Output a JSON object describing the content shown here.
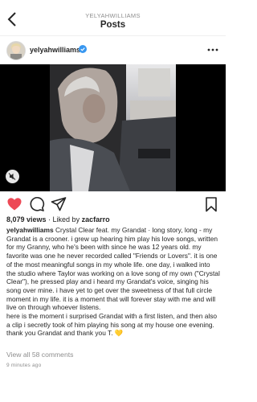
{
  "nav": {
    "account": "YELYAHWILLIAMS",
    "title": "Posts"
  },
  "post": {
    "username": "yelyahwilliams",
    "views_count": "8,079 views",
    "liked_by_prefix": " · Liked by ",
    "liked_by_user": "zacfarro",
    "caption_user": "yelyahwilliams",
    "caption_p1": " Crystal Clear feat. my Grandat · long story, long - my Grandat is a crooner. i grew up hearing him play his love songs, written for my Granny, who he's been with since he was 12 years old. my favorite was one he never recorded called \"Friends or Lovers\". it is one of the most meaningful songs in my whole life. one day, i walked into the studio where Taylor was working on a love song of my own (\"Crystal Clear\"), he pressed play and i heard my Grandat's voice, singing his song over mine. i have yet to get over the sweetness of that full circle moment in my life. it is a moment that will forever stay with me and will live on through whoever listens.",
    "caption_p2": "here is the moment i surprised Grandat with a first listen, and then also a clip i secretly took of him playing his song at my house one evening.",
    "caption_p3": "thank you Grandat and thank you T. 💛",
    "view_comments": "View all 58 comments",
    "timestamp": "9 minutes ago"
  },
  "colors": {
    "like_red": "#ed4956",
    "verified_blue": "#3897f0",
    "muted_text": "#8e8e8e"
  },
  "icons": {
    "back": "chevron-left-icon",
    "verified": "verified-badge-icon",
    "more": "more-options-icon",
    "mute": "speaker-muted-icon",
    "like": "heart-filled-icon",
    "comment": "comment-icon",
    "share": "paper-plane-icon",
    "save": "bookmark-icon"
  }
}
